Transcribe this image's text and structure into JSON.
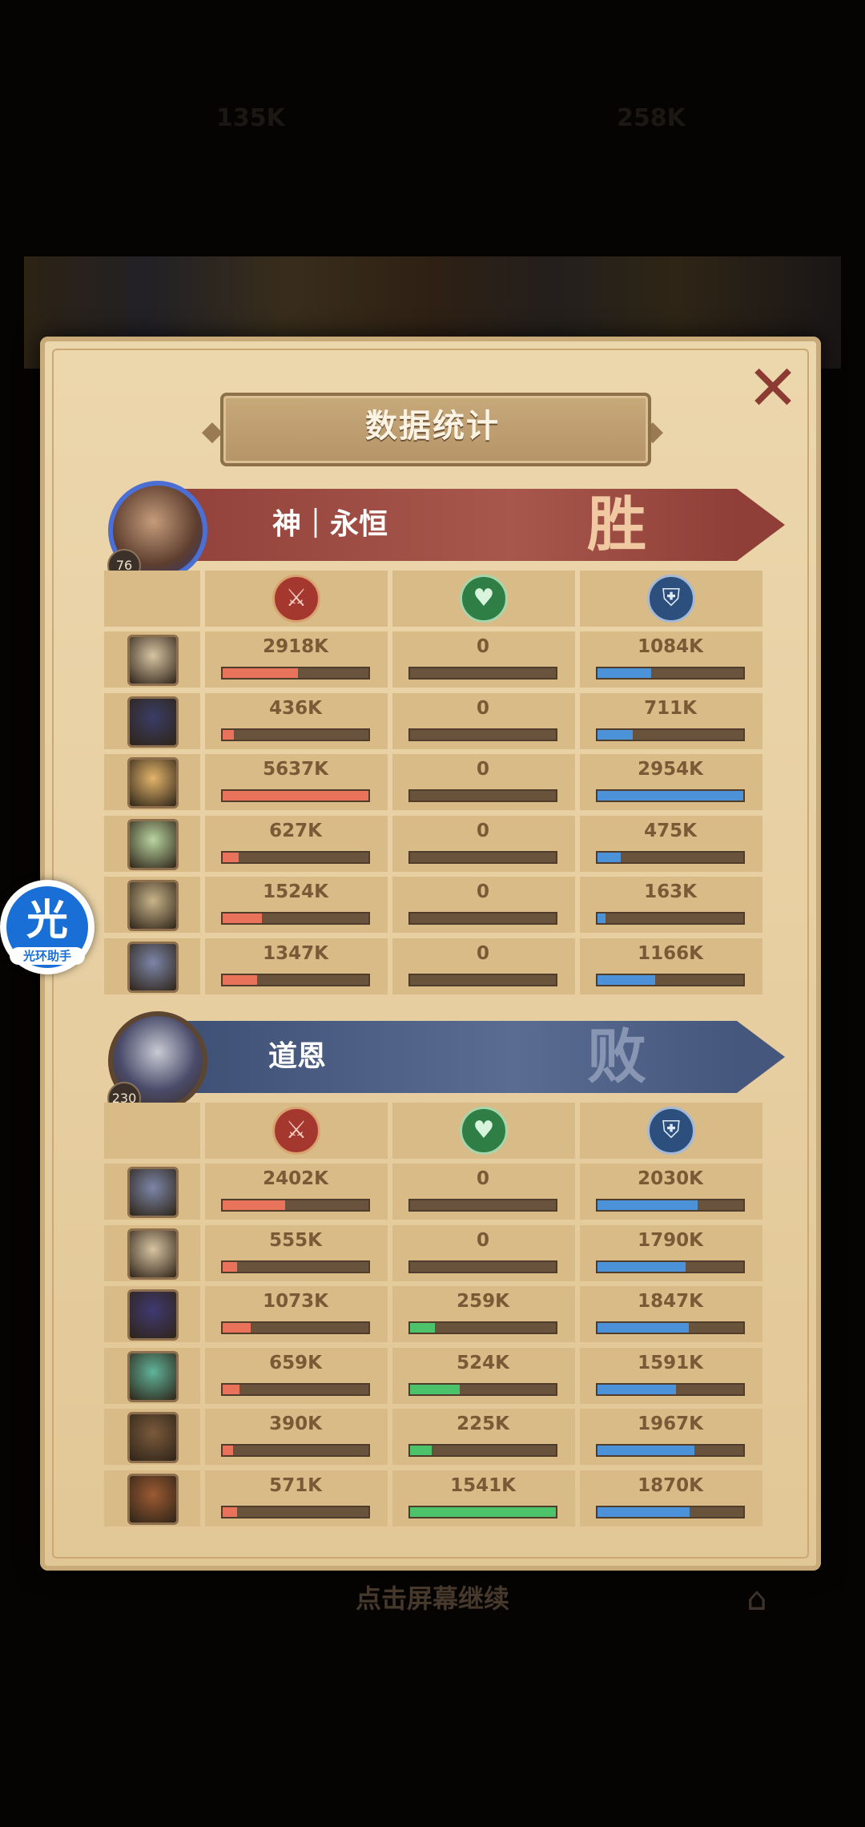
{
  "dialog": {
    "title": "数据统计",
    "close_symbol": "✕",
    "continue_hint": "点击屏幕继续",
    "bg_faint_left": "135K",
    "bg_faint_right": "258K"
  },
  "colors": {
    "damage": "#e8735a",
    "heal": "#4cc26b",
    "shield": "#4b92d8",
    "win_banner": "#a8574c",
    "lose_banner": "#5a6c92"
  },
  "icons": {
    "damage": "sword-icon",
    "heal": "heart-plus-icon",
    "shield": "shield-icon",
    "close": "close-icon",
    "home": "castle-icon"
  },
  "teams": [
    {
      "name": "神｜永恒",
      "level": "76",
      "result": "胜",
      "rows": [
        {
          "damage": "2918K",
          "heal": "0",
          "shield": "1084K",
          "damage_pct": 0.518,
          "heal_pct": 0,
          "shield_pct": 0.367
        },
        {
          "damage": "436K",
          "heal": "0",
          "shield": "711K",
          "damage_pct": 0.077,
          "heal_pct": 0,
          "shield_pct": 0.241
        },
        {
          "damage": "5637K",
          "heal": "0",
          "shield": "2954K",
          "damage_pct": 1.0,
          "heal_pct": 0,
          "shield_pct": 1.0
        },
        {
          "damage": "627K",
          "heal": "0",
          "shield": "475K",
          "damage_pct": 0.111,
          "heal_pct": 0,
          "shield_pct": 0.161
        },
        {
          "damage": "1524K",
          "heal": "0",
          "shield": "163K",
          "damage_pct": 0.27,
          "heal_pct": 0,
          "shield_pct": 0.055
        },
        {
          "damage": "1347K",
          "heal": "0",
          "shield": "1166K",
          "damage_pct": 0.239,
          "heal_pct": 0,
          "shield_pct": 0.395
        }
      ]
    },
    {
      "name": "道恩",
      "level": "230",
      "result": "败",
      "rows": [
        {
          "damage": "2402K",
          "heal": "0",
          "shield": "2030K",
          "damage_pct": 0.426,
          "heal_pct": 0,
          "shield_pct": 0.687
        },
        {
          "damage": "555K",
          "heal": "0",
          "shield": "1790K",
          "damage_pct": 0.098,
          "heal_pct": 0,
          "shield_pct": 0.606
        },
        {
          "damage": "1073K",
          "heal": "259K",
          "shield": "1847K",
          "damage_pct": 0.19,
          "heal_pct": 0.168,
          "shield_pct": 0.625
        },
        {
          "damage": "659K",
          "heal": "524K",
          "shield": "1591K",
          "damage_pct": 0.117,
          "heal_pct": 0.34,
          "shield_pct": 0.539
        },
        {
          "damage": "390K",
          "heal": "225K",
          "shield": "1967K",
          "damage_pct": 0.069,
          "heal_pct": 0.146,
          "shield_pct": 0.666
        },
        {
          "damage": "571K",
          "heal": "1541K",
          "shield": "1870K",
          "damage_pct": 0.101,
          "heal_pct": 1.0,
          "shield_pct": 0.633
        }
      ]
    }
  ],
  "assistant": {
    "glyph": "光",
    "label": "光环助手"
  }
}
